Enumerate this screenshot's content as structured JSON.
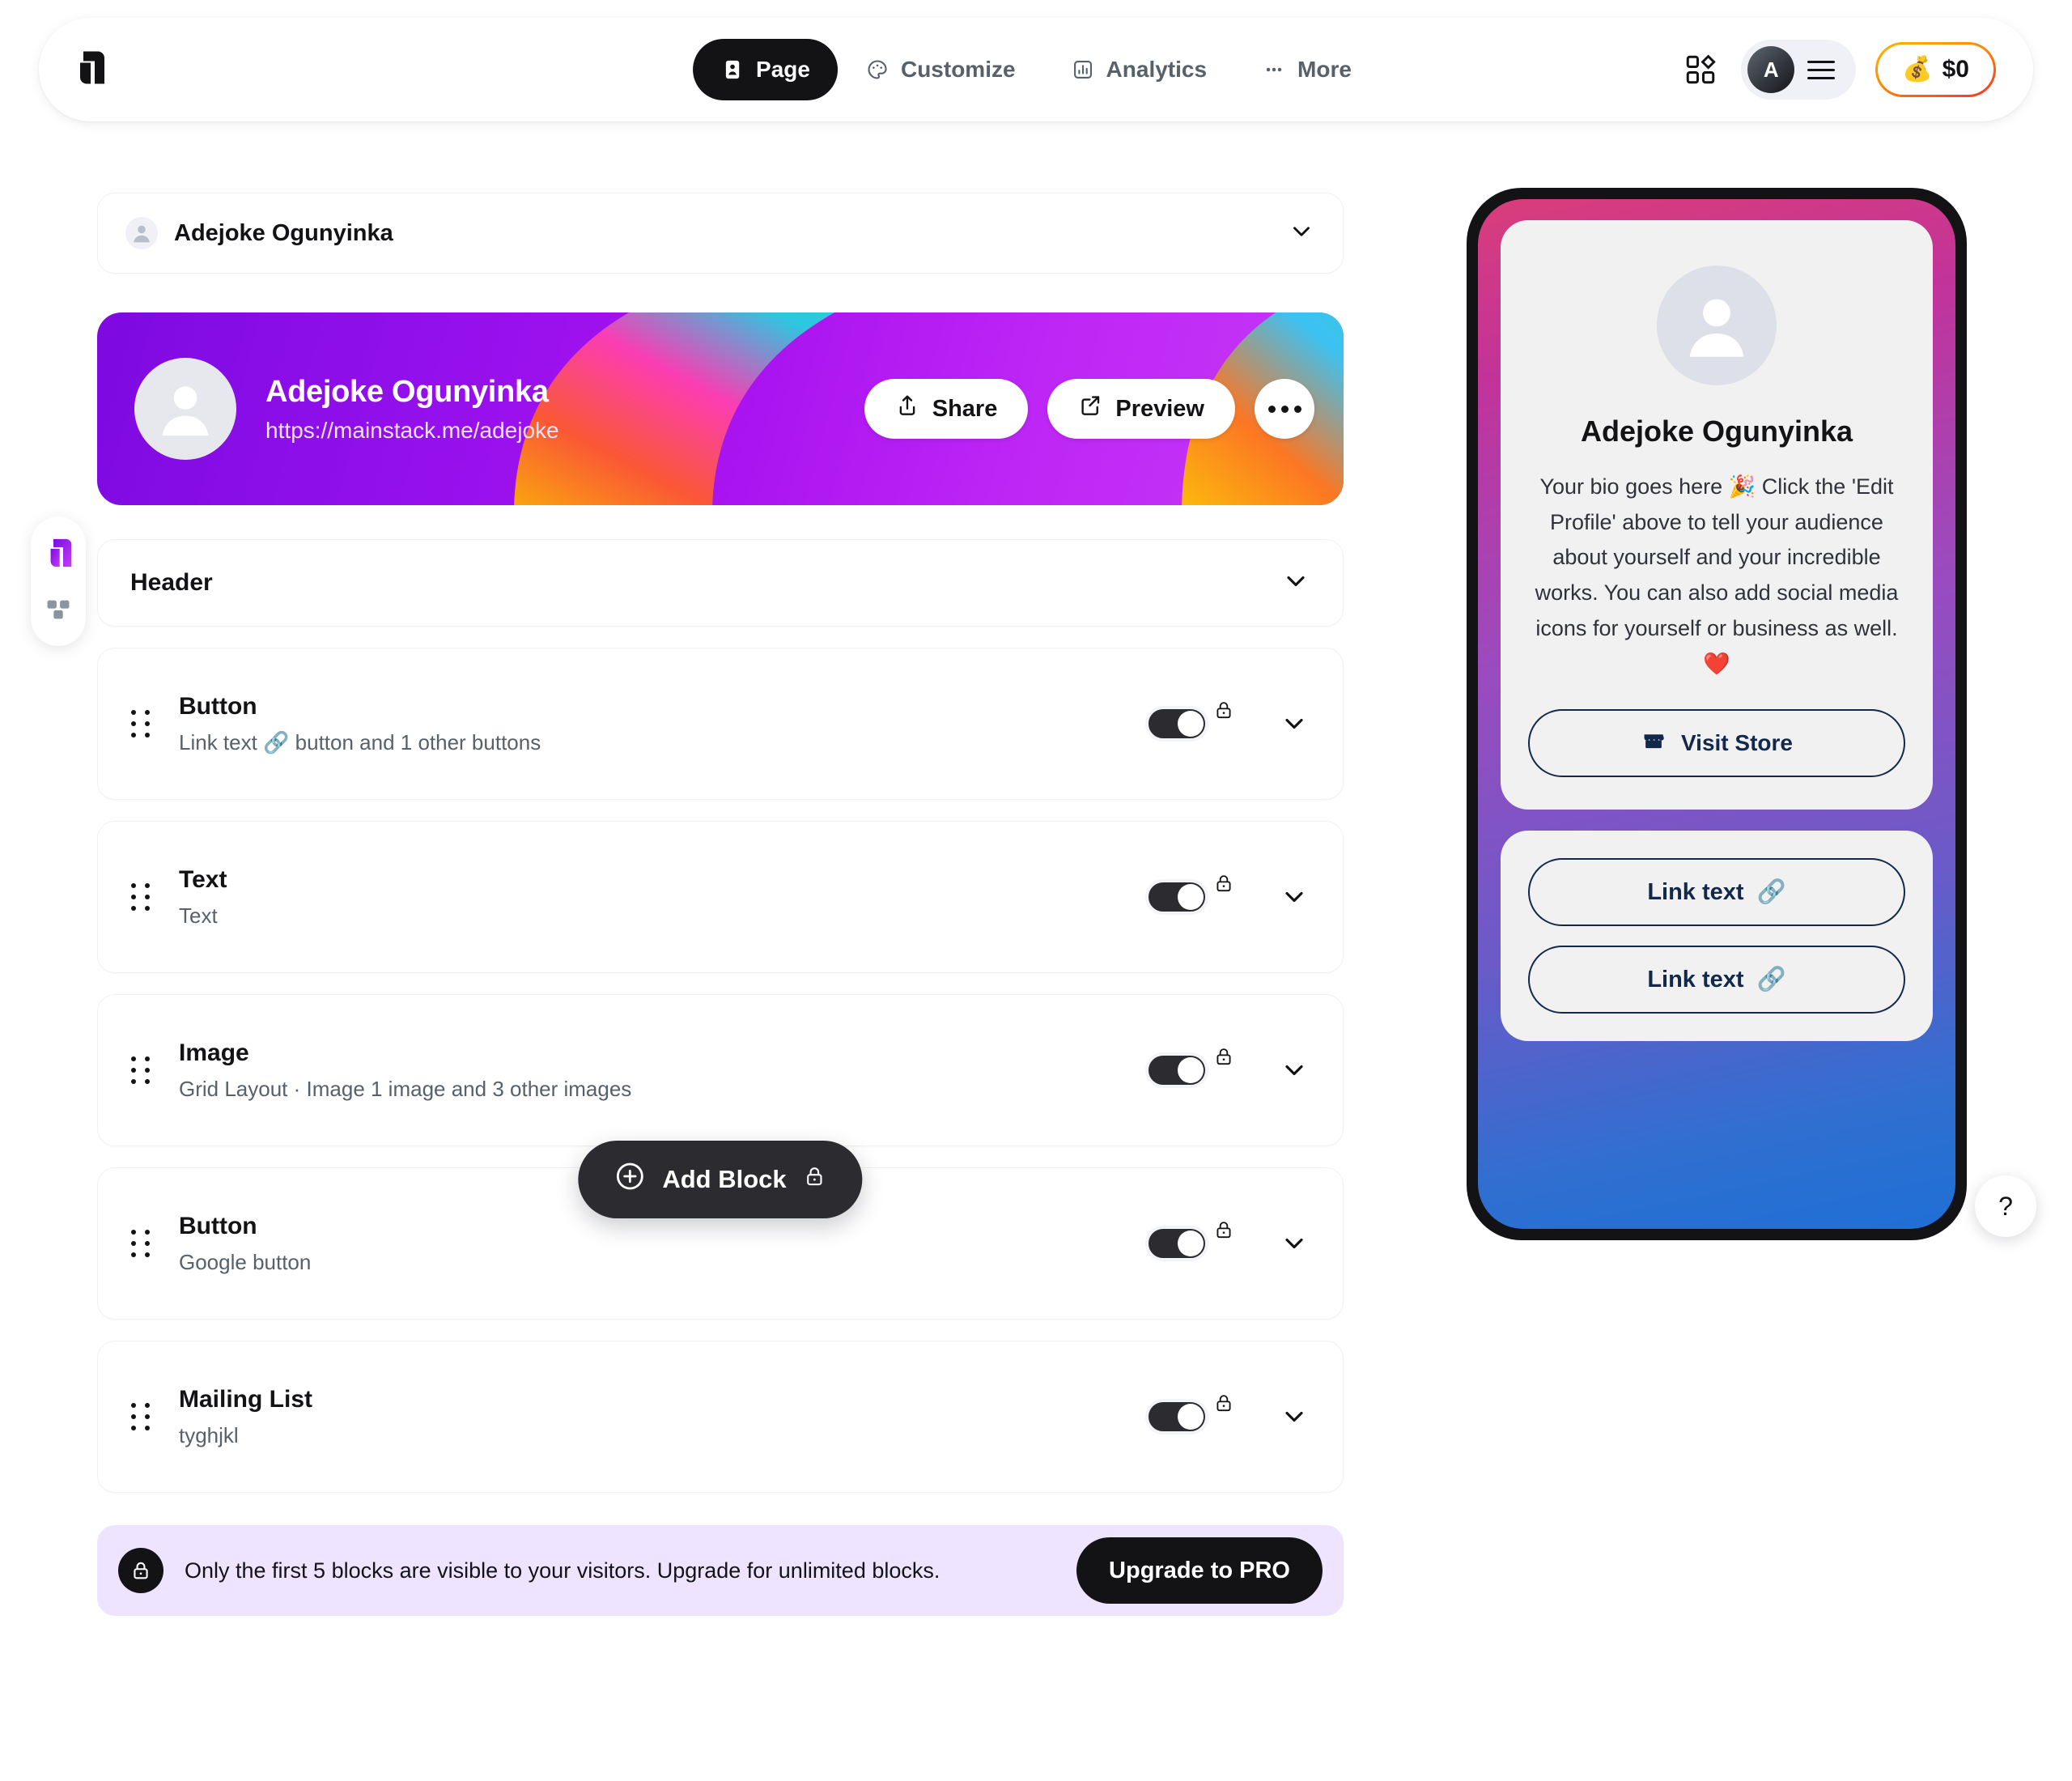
{
  "topbar": {
    "logo": "mainstack-logo",
    "nav": [
      {
        "id": "page",
        "label": "Page",
        "icon": "page-icon",
        "active": true
      },
      {
        "id": "customize",
        "label": "Customize",
        "icon": "palette-icon",
        "active": false
      },
      {
        "id": "analytics",
        "label": "Analytics",
        "icon": "analytics-icon",
        "active": false
      },
      {
        "id": "more",
        "label": "More",
        "icon": "ellipsis-icon",
        "active": false
      }
    ],
    "apps_icon": "apps-grid-icon",
    "avatar_initial": "A",
    "menu_icon": "hamburger-icon",
    "balance": "$0",
    "balance_emoji": "💰"
  },
  "rail": {
    "items": [
      {
        "id": "mainstack",
        "icon": "mainstack-logo-icon",
        "selected": true
      },
      {
        "id": "audience",
        "icon": "audience-icon",
        "selected": false
      }
    ]
  },
  "profile_select": {
    "name": "Adejoke Ogunyinka",
    "avatar_icon": "person-icon",
    "chevron_icon": "chevron-down-icon"
  },
  "banner": {
    "name": "Adejoke Ogunyinka",
    "url": "https://mainstack.me/adejoke",
    "avatar_icon": "person-icon",
    "share_label": "Share",
    "share_icon": "share-upload-icon",
    "preview_label": "Preview",
    "preview_icon": "external-link-icon",
    "more_icon": "ellipsis-icon",
    "gradient_start": "#7d0ae0",
    "gradient_end": "#c639f7"
  },
  "header_card": {
    "title": "Header",
    "chevron_icon": "chevron-down-icon"
  },
  "blocks": [
    {
      "title": "Button",
      "subtitle": "Link text 🔗 button and 1 other buttons",
      "enabled": true,
      "locked": true
    },
    {
      "title": "Text",
      "subtitle": "Text",
      "enabled": true,
      "locked": true
    },
    {
      "title": "Image",
      "subtitle": "Grid Layout · Image 1 image and 3 other images",
      "enabled": true,
      "locked": true
    },
    {
      "title": "Button",
      "subtitle": "Google button",
      "enabled": true,
      "locked": true
    },
    {
      "title": "Mailing List",
      "subtitle": "tyghjkl",
      "enabled": true,
      "locked": true
    }
  ],
  "add_block": {
    "label": "Add Block",
    "plus_icon": "plus-circle-icon",
    "lock_icon": "lock-icon"
  },
  "upgrade": {
    "lock_icon": "lock-icon",
    "message": "Only the first 5 blocks are visible to your visitors. Upgrade for unlimited blocks.",
    "button_label": "Upgrade to PRO",
    "background": "#eee4ff"
  },
  "preview": {
    "name": "Adejoke Ogunyinka",
    "bio": "Your bio goes here 🎉 Click the 'Edit Profile' above to tell your audience about yourself and your incredible works. You can also add social media icons for yourself or business as well. ❤️",
    "avatar_icon": "person-icon",
    "store_button": {
      "label": "Visit Store",
      "icon": "storefront-icon"
    },
    "links": [
      {
        "label": "Link text",
        "icon": "link-emoji"
      },
      {
        "label": "Link text",
        "icon": "link-emoji"
      }
    ],
    "gradient_top": "#d93d7a",
    "gradient_bottom": "#1f6fd6"
  },
  "help_fab": {
    "label": "?"
  }
}
